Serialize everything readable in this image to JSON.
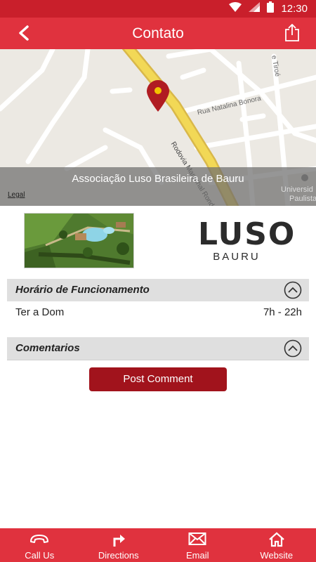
{
  "status_bar": {
    "time": "12:30",
    "icons": [
      "wifi-icon",
      "signal-icon",
      "battery-icon"
    ]
  },
  "app_bar": {
    "title": "Contato",
    "back_icon": "back-arrow-icon",
    "share_icon": "share-icon"
  },
  "map": {
    "caption": "Associação Luso Brasileira de Bauru",
    "legal": "Legal",
    "streets": {
      "natalina": "Rua Natalina Bonora",
      "rodovia": "Rodovia Marechal Rondon",
      "tiroe": "e Tiroé",
      "univ1": "Universid",
      "univ2": "Paulista"
    }
  },
  "logo": {
    "line1": "LUSO",
    "line2": "BAURU"
  },
  "hours_section": {
    "title": "Horário de Funcionamento",
    "rows": [
      {
        "day": "Ter a Dom",
        "time": "7h - 22h"
      }
    ]
  },
  "comments_section": {
    "title": "Comentarios"
  },
  "post_comment_label": "Post Comment",
  "tabs": [
    {
      "label": "Call Us",
      "icon": "phone-icon"
    },
    {
      "label": "Directions",
      "icon": "directions-icon"
    },
    {
      "label": "Email",
      "icon": "email-icon"
    },
    {
      "label": "Website",
      "icon": "home-icon"
    }
  ],
  "colors": {
    "primary": "#e0323e",
    "status_bar": "#c91f2b",
    "button": "#a1131c",
    "pin": "#b01c22"
  }
}
